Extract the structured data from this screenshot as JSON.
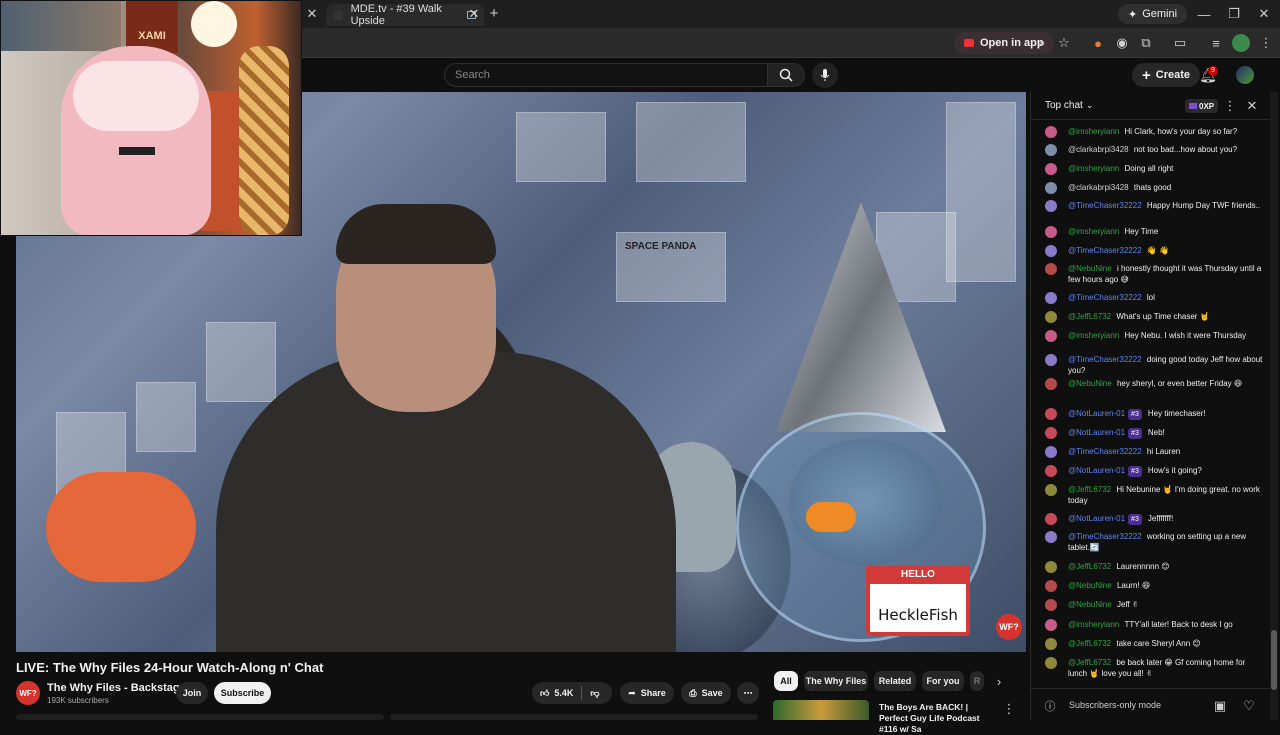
{
  "browser": {
    "tab_title": "MDE.tv - #39 Walk Upside",
    "new_tab_glyph": "+",
    "gemini_label": "Gemini",
    "open_in_app": "Open in app"
  },
  "youtube_header": {
    "search_placeholder": "Search",
    "create_label": "Create",
    "notification_count": "9"
  },
  "webcam": {
    "poster_text": "XAMI"
  },
  "video": {
    "sign_top": "HELLO",
    "sign_name": "HeckleFish",
    "space_panda": "SPACE PANDA",
    "channel_badge": "WF?"
  },
  "watch": {
    "title": "LIVE: The Why Files 24-Hour Watch-Along n' Chat",
    "channel_name": "The Why Files - Backstage",
    "channel_avatar_text": "WF?",
    "subscribers": "193K subscribers",
    "join_label": "Join",
    "subscribe_label": "Subscribe",
    "like_count": "5.4K",
    "share_label": "Share",
    "save_label": "Save"
  },
  "chips": [
    "All",
    "The Why Files",
    "Related",
    "For you",
    "R"
  ],
  "recommendation": {
    "title": "The Boys Are BACK! | Perfect Guy Life Podcast #116 w/ Sa"
  },
  "chat": {
    "header": "Top chat",
    "xp_label": "0XP",
    "footer": "Subscribers-only mode",
    "messages": [
      {
        "user": "@imsheryiann",
        "text": "Hi Clark, how's your day so far?",
        "member": false,
        "color": "#c75b8a"
      },
      {
        "user": "@clarkabrpi3428",
        "text": "not too bad...how about you?",
        "member": false,
        "color": "#7d8fa8",
        "plain": true
      },
      {
        "user": "@imsheryiann",
        "text": "Doing all right",
        "member": false,
        "color": "#c75b8a"
      },
      {
        "user": "@clarkabrpi3428",
        "text": "thats good",
        "member": false,
        "color": "#7d8fa8",
        "plain": true
      },
      {
        "user": "@TimeChaser32222",
        "text": "Happy Hump Day TWF friends..",
        "member": true,
        "color": "#8a7ac9"
      },
      {
        "user": "@imsheryiann",
        "text": "Hey Time",
        "member": false,
        "color": "#c75b8a"
      },
      {
        "user": "@TimeChaser32222",
        "text": "👋 👋",
        "member": true,
        "color": "#8a7ac9"
      },
      {
        "user": "@NebuNine",
        "text": "i honestly thought it was Thursday until a few hours ago 😅",
        "member": false,
        "color": "#b54a4a"
      },
      {
        "user": "@TimeChaser32222",
        "text": "lol",
        "member": true,
        "color": "#8a7ac9"
      },
      {
        "user": "@JeffL6732",
        "text": "What's up Time chaser 🤘",
        "member": false,
        "color": "#8f8a3a"
      },
      {
        "user": "@imsheryiann",
        "text": "Hey Nebu. I wish it were Thursday",
        "member": false,
        "color": "#c75b8a"
      },
      {
        "user": "@TimeChaser32222",
        "text": "doing good today Jeff how about you?",
        "member": true,
        "color": "#8a7ac9"
      },
      {
        "user": "@NebuNine",
        "text": "hey sheryl, or even better Friday 😆",
        "member": false,
        "color": "#b54a4a"
      },
      {
        "user": "@NotLauren-01",
        "text": "Hey timechaser!",
        "member": true,
        "color": "#c74a5a",
        "badge": "#3"
      },
      {
        "user": "@NotLauren-01",
        "text": "Neb!",
        "member": true,
        "color": "#c74a5a",
        "badge": "#3"
      },
      {
        "user": "@TimeChaser32222",
        "text": "hi Lauren",
        "member": true,
        "color": "#8a7ac9"
      },
      {
        "user": "@NotLauren-01",
        "text": "How's it going?",
        "member": true,
        "color": "#c74a5a",
        "badge": "#3"
      },
      {
        "user": "@JeffL6732",
        "text": "Hi Nebunine 🤘 I'm doing great. no work today",
        "member": false,
        "color": "#8f8a3a"
      },
      {
        "user": "@NotLauren-01",
        "text": "Jefffffff!",
        "member": true,
        "color": "#c74a5a",
        "badge": "#3"
      },
      {
        "user": "@TimeChaser32222",
        "text": "working on setting up a new tablet.🔄",
        "member": true,
        "color": "#8a7ac9"
      },
      {
        "user": "@JeffL6732",
        "text": "Laurennnnn 😊",
        "member": false,
        "color": "#8f8a3a"
      },
      {
        "user": "@NebuNine",
        "text": "Laurn! 😆",
        "member": false,
        "color": "#b54a4a"
      },
      {
        "user": "@NebuNine",
        "text": "Jeff ✌",
        "member": false,
        "color": "#b54a4a"
      },
      {
        "user": "@imsheryiann",
        "text": "TTY'all later! Back to desk I go",
        "member": false,
        "color": "#c75b8a"
      },
      {
        "user": "@JeffL6732",
        "text": "take care Sheryl Ann 😊",
        "member": false,
        "color": "#8f8a3a"
      },
      {
        "user": "@JeffL6732",
        "text": "be back later 😁 Gf coming home for lunch 🤘 love you all! ✌",
        "member": false,
        "color": "#8f8a3a"
      }
    ]
  }
}
